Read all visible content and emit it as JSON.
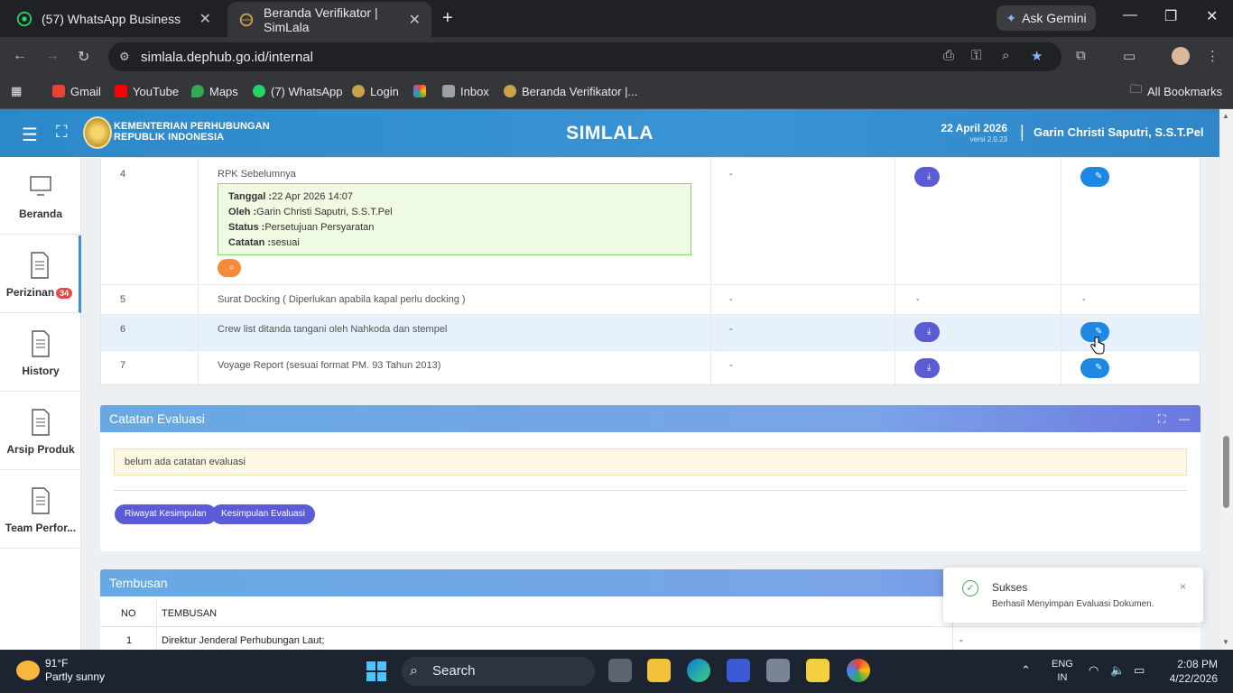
{
  "browser": {
    "tabs": [
      {
        "title": "(57) WhatsApp Business",
        "active": false
      },
      {
        "title": "Beranda Verifikator | SimLala",
        "active": true
      }
    ],
    "ask_gemini": "Ask Gemini",
    "url": "simlala.dephub.go.id/internal",
    "bookmarks": [
      "Gmail",
      "YouTube",
      "Maps",
      "(7) WhatsApp",
      "Login",
      "Inbox",
      "Beranda Verifikator |..."
    ],
    "all_bookmarks": "All Bookmarks"
  },
  "header": {
    "ministry_line1": "KEMENTERIAN PERHUBUNGAN",
    "ministry_line2": "REPUBLIK INDONESIA",
    "app_title": "SIMLALA",
    "date": "22 April 2026",
    "version": "versi 2.0.23",
    "separator": "|",
    "user": "Garin Christi Saputri, S.S.T.Pel"
  },
  "sidebar": {
    "items": [
      {
        "label": "Beranda",
        "icon": "monitor-icon"
      },
      {
        "label": "Perizinan",
        "icon": "document-icon",
        "badge": "34"
      },
      {
        "label": "History",
        "icon": "document-icon"
      },
      {
        "label": "Arsip Produk",
        "icon": "document-icon"
      },
      {
        "label": "Team Perfor...",
        "icon": "document-icon"
      }
    ]
  },
  "documents": {
    "rows": [
      {
        "no": "4",
        "name": "RPK Sebelumnya",
        "col3": "-",
        "info": {
          "tanggal_label": "Tanggal :",
          "tanggal": "22 Apr 2026 14:07",
          "oleh_label": "Oleh :",
          "oleh": "Garin Christi Saputri, S.S.T.Pel",
          "status_label": "Status :",
          "status": "Persetujuan Persyaratan",
          "catatan_label": "Catatan :",
          "catatan": "sesuai"
        }
      },
      {
        "no": "5",
        "name": "Surat Docking ( Diperlukan apabila kapal perlu docking )",
        "col3": "-",
        "col4": "-",
        "col5": "-"
      },
      {
        "no": "6",
        "name": "Crew list ditanda tangani oleh Nahkoda dan stempel",
        "col3": "-"
      },
      {
        "no": "7",
        "name": "Voyage Report (sesuai format PM. 93 Tahun 2013)",
        "col3": "-"
      }
    ]
  },
  "evaluasi": {
    "title": "Catatan Evaluasi",
    "note": "belum ada catatan evaluasi",
    "btn_riwayat": "Riwayat Kesimpulan",
    "btn_kesimpulan": "Kesimpulan Evaluasi"
  },
  "tembusan": {
    "title": "Tembusan",
    "col_no": "NO",
    "col_tembusan": "TEMBUSAN",
    "rows": [
      {
        "no": "1",
        "text": "Direktur Jenderal Perhubungan Laut;",
        "extra": "-"
      }
    ]
  },
  "toast": {
    "title": "Sukses",
    "message": "Berhasil Menyimpan Evaluasi Dokumen.",
    "close": "×"
  },
  "taskbar": {
    "temperature": "91°F",
    "weather": "Partly sunny",
    "search": "Search",
    "lang1": "ENG",
    "lang2": "IN",
    "time": "2:08 PM",
    "date": "4/22/2026"
  },
  "colors": {
    "accent": "#2c89c9",
    "success": "#4caf50",
    "download": "#5b5bd6",
    "edit": "#1e88e5"
  }
}
